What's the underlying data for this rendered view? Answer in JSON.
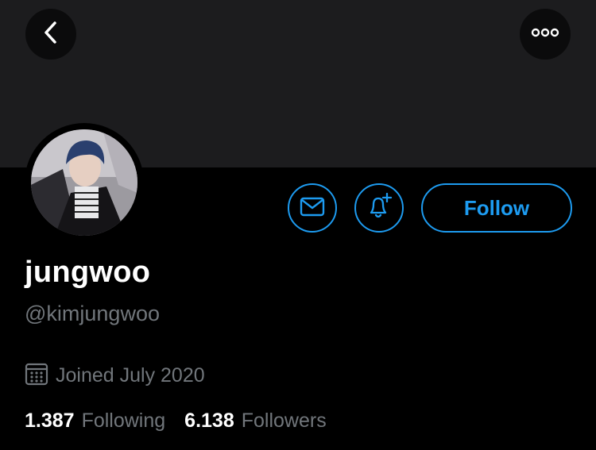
{
  "colors": {
    "accent": "#1d9bf0",
    "muted": "#71767b",
    "text": "#ffffff",
    "background": "#000000",
    "banner": "#1c1c1e"
  },
  "header": {
    "back_icon": "chevron-left-icon",
    "more_icon": "more-horizontal-icon"
  },
  "profile": {
    "avatar": "profile-photo",
    "display_name": "jungwoo",
    "handle": "@kimjungwoo",
    "joined": "Joined July 2020",
    "joined_icon": "calendar-icon"
  },
  "actions": {
    "message_icon": "envelope-icon",
    "notify_icon": "bell-plus-icon",
    "follow_label": "Follow"
  },
  "stats": {
    "following_count": "1.387",
    "following_label": "Following",
    "followers_count": "6.138",
    "followers_label": "Followers"
  }
}
